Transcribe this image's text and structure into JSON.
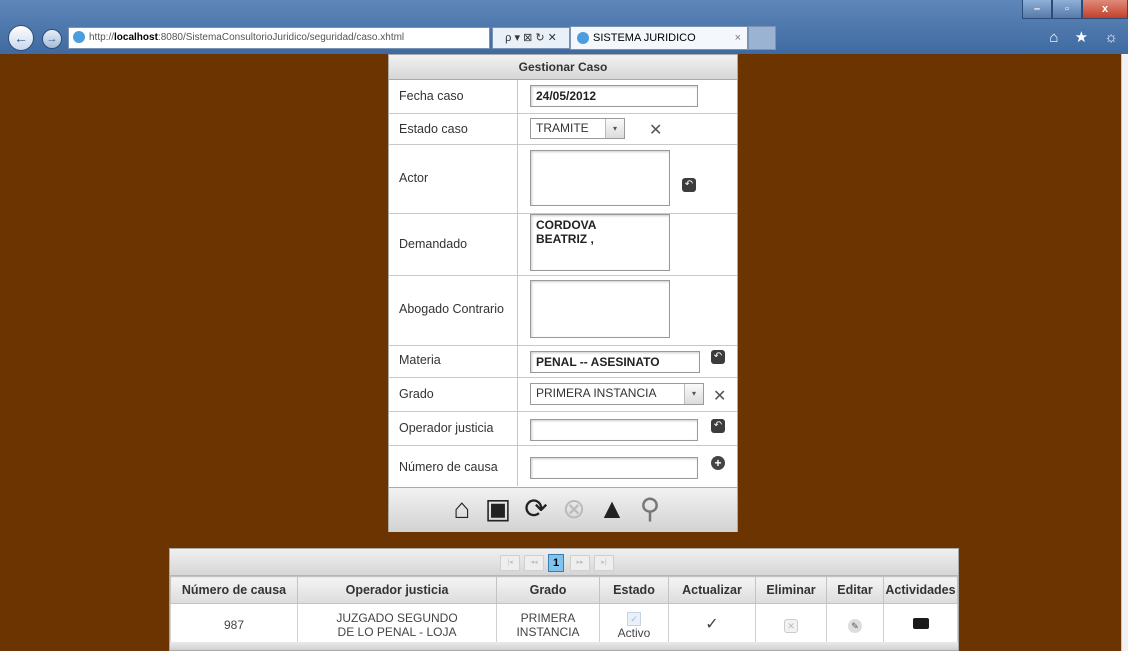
{
  "browser": {
    "url_prefix": "http://",
    "url_host": "localhost",
    "url_rest": ":8080/SistemaConsultorioJuridico/seguridad/caso.xhtml",
    "addr_tools": "ρ ▾ ⊠ ↻ ✕",
    "tab_title": "SISTEMA JURIDICO",
    "tab_close": "×",
    "right_icons": "⌂ ★ ☼",
    "win_min": "–",
    "win_max": "▫",
    "win_close": "x",
    "back": "←",
    "forward": "→"
  },
  "form": {
    "title": "Gestionar Caso",
    "fecha_label": "Fecha caso",
    "fecha_value": "24/05/2012",
    "estado_label": "Estado caso",
    "estado_value": "TRAMITE",
    "actor_label": "Actor",
    "actor_value": "",
    "demandado_label": "Demandado",
    "demandado_value": "CORDOVA\nBEATRIZ ,",
    "abogado_label": "Abogado Contrario",
    "abogado_value": "",
    "materia_label": "Materia",
    "materia_value": "PENAL -- ASESINATO",
    "grado_label": "Grado",
    "grado_value": "PRIMERA INSTANCIA",
    "operador_label": "Operador justicia",
    "operador_value": "",
    "numero_label": "Número de causa",
    "numero_value": ""
  },
  "icons": {
    "arrow": "▾",
    "tool": "✕",
    "pick": "↶",
    "plus": "+",
    "home": "⌂",
    "save": "▣",
    "refresh": "⟳",
    "delete": "⊗",
    "clear": "▲",
    "search": "⚲"
  },
  "table": {
    "pager": {
      "first": "|◂",
      "prev": "◂◂",
      "page": "1",
      "next": "▸▸",
      "last": "▸|"
    },
    "headers": [
      "Número de causa",
      "Operador justicia",
      "Grado",
      "Estado",
      "Actualizar",
      "Eliminar",
      "Editar",
      "Actividades"
    ],
    "rows": [
      {
        "numero": "987",
        "operador": "JUZGADO SEGUNDO\nDE LO PENAL - LOJA",
        "grado": "PRIMERA\nINSTANCIA",
        "estado": "Activo",
        "actualizar": "✓"
      }
    ]
  }
}
